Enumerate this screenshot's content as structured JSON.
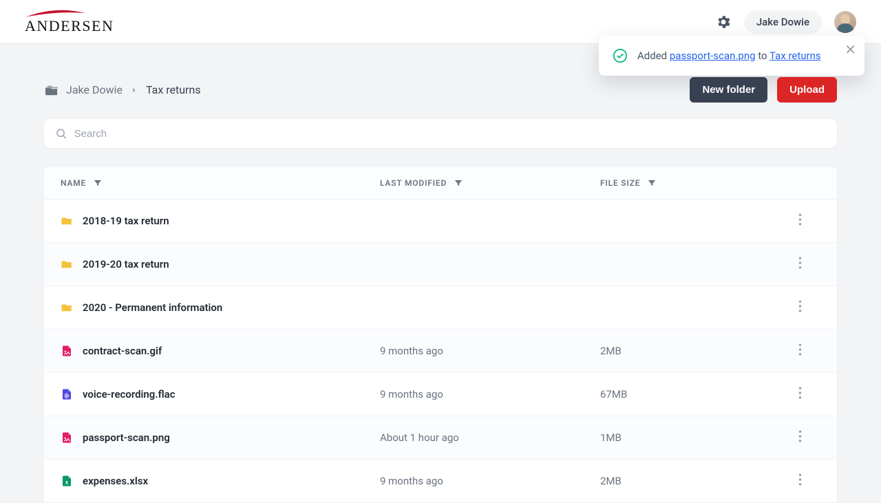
{
  "brand": "ANDERSEN",
  "user": {
    "name": "Jake Dowie"
  },
  "toast": {
    "prefix": "Added",
    "file": "passport-scan.png",
    "mid": "to",
    "folder": "Tax returns"
  },
  "breadcrumb": {
    "root": "Jake Dowie",
    "current": "Tax returns"
  },
  "buttons": {
    "new_folder": "New folder",
    "upload": "Upload"
  },
  "search": {
    "placeholder": "Search"
  },
  "columns": {
    "name": "NAME",
    "modified": "LAST MODIFIED",
    "size": "FILE SIZE"
  },
  "rows": [
    {
      "type": "folder",
      "name": "2018-19 tax return",
      "modified": "",
      "size": ""
    },
    {
      "type": "folder",
      "name": "2019-20 tax return",
      "modified": "",
      "size": ""
    },
    {
      "type": "folder",
      "name": "2020 - Permanent information",
      "modified": "",
      "size": ""
    },
    {
      "type": "image",
      "name": "contract-scan.gif",
      "modified": "9 months ago",
      "size": "2MB"
    },
    {
      "type": "audio",
      "name": "voice-recording.flac",
      "modified": "9 months ago",
      "size": "67MB"
    },
    {
      "type": "image",
      "name": "passport-scan.png",
      "modified": "About 1 hour ago",
      "size": "1MB"
    },
    {
      "type": "sheet",
      "name": "expenses.xlsx",
      "modified": "9 months ago",
      "size": "2MB"
    }
  ],
  "icons": {
    "folder_color": "#f3c33c",
    "image_color": "#e11d67",
    "audio_color": "#4f46e5",
    "sheet_color": "#059669"
  }
}
